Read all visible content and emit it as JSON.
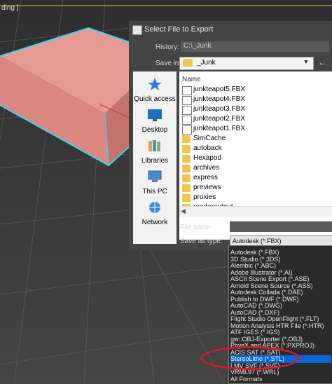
{
  "viewport": {
    "label": "ding ]"
  },
  "dialog": {
    "title": "Select File to Export",
    "history_label": "History:",
    "history_value": "C:\\_Junk",
    "savein_label": "Save in:",
    "savein_value": "_Junk",
    "places": [
      {
        "label": "Quick access",
        "icon": "star-icon"
      },
      {
        "label": "Desktop",
        "icon": "desktop-icon"
      },
      {
        "label": "Libraries",
        "icon": "libraries-icon"
      },
      {
        "label": "This PC",
        "icon": "computer-icon"
      },
      {
        "label": "Network",
        "icon": "network-icon"
      }
    ],
    "column_name": "Name",
    "files": [
      {
        "name": "junkteapot5.FBX",
        "kind": "file"
      },
      {
        "name": "junkteapot4.FBX",
        "kind": "file"
      },
      {
        "name": "junkteapot3.FBX",
        "kind": "file"
      },
      {
        "name": "junkteapot2.FBX",
        "kind": "file"
      },
      {
        "name": "junkteapot1.FBX",
        "kind": "file"
      },
      {
        "name": "SimCache",
        "kind": "folder"
      },
      {
        "name": "autoback",
        "kind": "folder"
      },
      {
        "name": "Hexapod",
        "kind": "folder"
      },
      {
        "name": "archives",
        "kind": "folder"
      },
      {
        "name": "express",
        "kind": "folder"
      },
      {
        "name": "previews",
        "kind": "folder"
      },
      {
        "name": "proxies",
        "kind": "folder"
      },
      {
        "name": "renderoutput",
        "kind": "folder"
      }
    ],
    "filename_label": "File name:",
    "filename_value": "",
    "type_label": "Save as type:",
    "type_value": "Autodesk (*.FBX)"
  },
  "dropdown": {
    "options": [
      "Autodesk (*.FBX)",
      "3D Studio (*.3DS)",
      "Alembic (*.ABC)",
      "Adobe Illustrator (*.AI)",
      "ASCII Scene Export (*.ASE)",
      "Arnold Scene Source (*.ASS)",
      "Autodesk Collada (*.DAE)",
      "Publish to DWF (*.DWF)",
      "AutoCAD (*.DWG)",
      "AutoCAD (*.DXF)",
      "Flight Studio OpenFlight (*.FLT)",
      "Motion Analysis HTR File (*.HTR)",
      "ATF IGES (*.IGS)",
      "gw::OBJ-Exporter (*.OBJ)",
      "PhysX and APEX (*.PXPROJ)",
      "ACIS SAT (*.SAT)",
      "StereoLitho (*.STL)",
      "LMV SVF (*.SVF)",
      "VRML97 (*.WRL)",
      "All Formats"
    ],
    "selected_index": 16
  },
  "colors": {
    "selection": "#0a66d6",
    "annotation": "#d41b2c",
    "object": "#e8908a"
  }
}
